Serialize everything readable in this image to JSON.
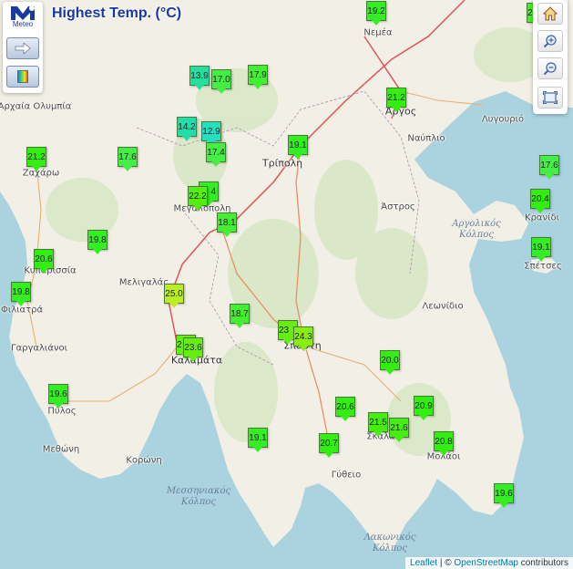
{
  "title": "Highest Temp. (°C)",
  "logo": {
    "text": "Meteo"
  },
  "attribution": {
    "leaflet": "Leaflet",
    "separator": " | © ",
    "osm": "OpenStreetMap",
    "suffix": " contributors"
  },
  "toolbar": {
    "icons": [
      "home-icon",
      "zoom-in-icon",
      "zoom-out-icon",
      "fullscreen-icon"
    ]
  },
  "places": [
    {
      "name": "Νεμέα"
    },
    {
      "name": "Αρχαία Ολυμπία"
    },
    {
      "name": "Άργος"
    },
    {
      "name": "Λυγουριό"
    },
    {
      "name": "Ναύπλιο"
    },
    {
      "name": "Ζαχάρω"
    },
    {
      "name": "Τρίπολη"
    },
    {
      "name": "Μεγαλόπολη"
    },
    {
      "name": "Άστρος"
    },
    {
      "name": "Κρανίδι"
    },
    {
      "name": "Σπέτσες"
    },
    {
      "name": "Κυπαρισσία"
    },
    {
      "name": "Μελιγαλάς"
    },
    {
      "name": "Φιλιατρά"
    },
    {
      "name": "Λεωνίδιο"
    },
    {
      "name": "Γαργαλιάνοι"
    },
    {
      "name": "Σπάρτη"
    },
    {
      "name": "Καλαμάτα"
    },
    {
      "name": "Πύλος"
    },
    {
      "name": "Σκάλα"
    },
    {
      "name": "Μολάοι"
    },
    {
      "name": "Μεθώνη"
    },
    {
      "name": "Κορώνη"
    },
    {
      "name": "Γύθειο"
    }
  ],
  "seas": [
    {
      "line1": "Αργολικός",
      "line2": "Κόλπος"
    },
    {
      "line1": "Μεσσηνιακός",
      "line2": "Κόλπος"
    },
    {
      "line1": "Λακωνικός",
      "line2": "Κόλπος"
    }
  ],
  "markers": [
    {
      "value": "19.2",
      "color": "#33ee22"
    },
    {
      "value": "2",
      "color": "#44f022"
    },
    {
      "value": "13.9",
      "color": "#22e0a0"
    },
    {
      "value": "17.0",
      "color": "#44ee44"
    },
    {
      "value": "17.9",
      "color": "#44ee33"
    },
    {
      "value": "21.2",
      "color": "#33ee11"
    },
    {
      "value": "14.2",
      "color": "#22ddaa"
    },
    {
      "value": "12.9",
      "color": "#22e0c0"
    },
    {
      "value": "17.4",
      "color": "#44ee44"
    },
    {
      "value": "21.2",
      "color": "#33ee11"
    },
    {
      "value": "17.6",
      "color": "#44ee44"
    },
    {
      "value": "19.1",
      "color": "#33ee22"
    },
    {
      "value": "17.6",
      "color": "#44ee44"
    },
    {
      "value": "4",
      "color": "#33ee22"
    },
    {
      "value": "22.2",
      "color": "#55ee11"
    },
    {
      "value": "20.4",
      "color": "#33ee11"
    },
    {
      "value": "18.1",
      "color": "#44ee33"
    },
    {
      "value": "19.8",
      "color": "#33ee22"
    },
    {
      "value": "19.1",
      "color": "#33ee22"
    },
    {
      "value": "20.6",
      "color": "#33ee11"
    },
    {
      "value": "19.8",
      "color": "#33ee22"
    },
    {
      "value": "25.0",
      "color": "#bbee22"
    },
    {
      "value": "18.7",
      "color": "#44ee33"
    },
    {
      "value": "23",
      "color": "#66ee11"
    },
    {
      "value": "24.3",
      "color": "#88ee11"
    },
    {
      "value": "2",
      "color": "#66ee11"
    },
    {
      "value": "23.6",
      "color": "#66ee11"
    },
    {
      "value": "20.0",
      "color": "#33ee11"
    },
    {
      "value": "19.6",
      "color": "#33ee22"
    },
    {
      "value": "20.6",
      "color": "#33ee11"
    },
    {
      "value": "20.9",
      "color": "#33ee11"
    },
    {
      "value": "21.5",
      "color": "#44ee11"
    },
    {
      "value": "21.6",
      "color": "#44ee11"
    },
    {
      "value": "19.1",
      "color": "#33ee22"
    },
    {
      "value": "20.7",
      "color": "#33ee11"
    },
    {
      "value": "20.8",
      "color": "#33ee11"
    },
    {
      "value": "19.6",
      "color": "#33ee22"
    }
  ]
}
